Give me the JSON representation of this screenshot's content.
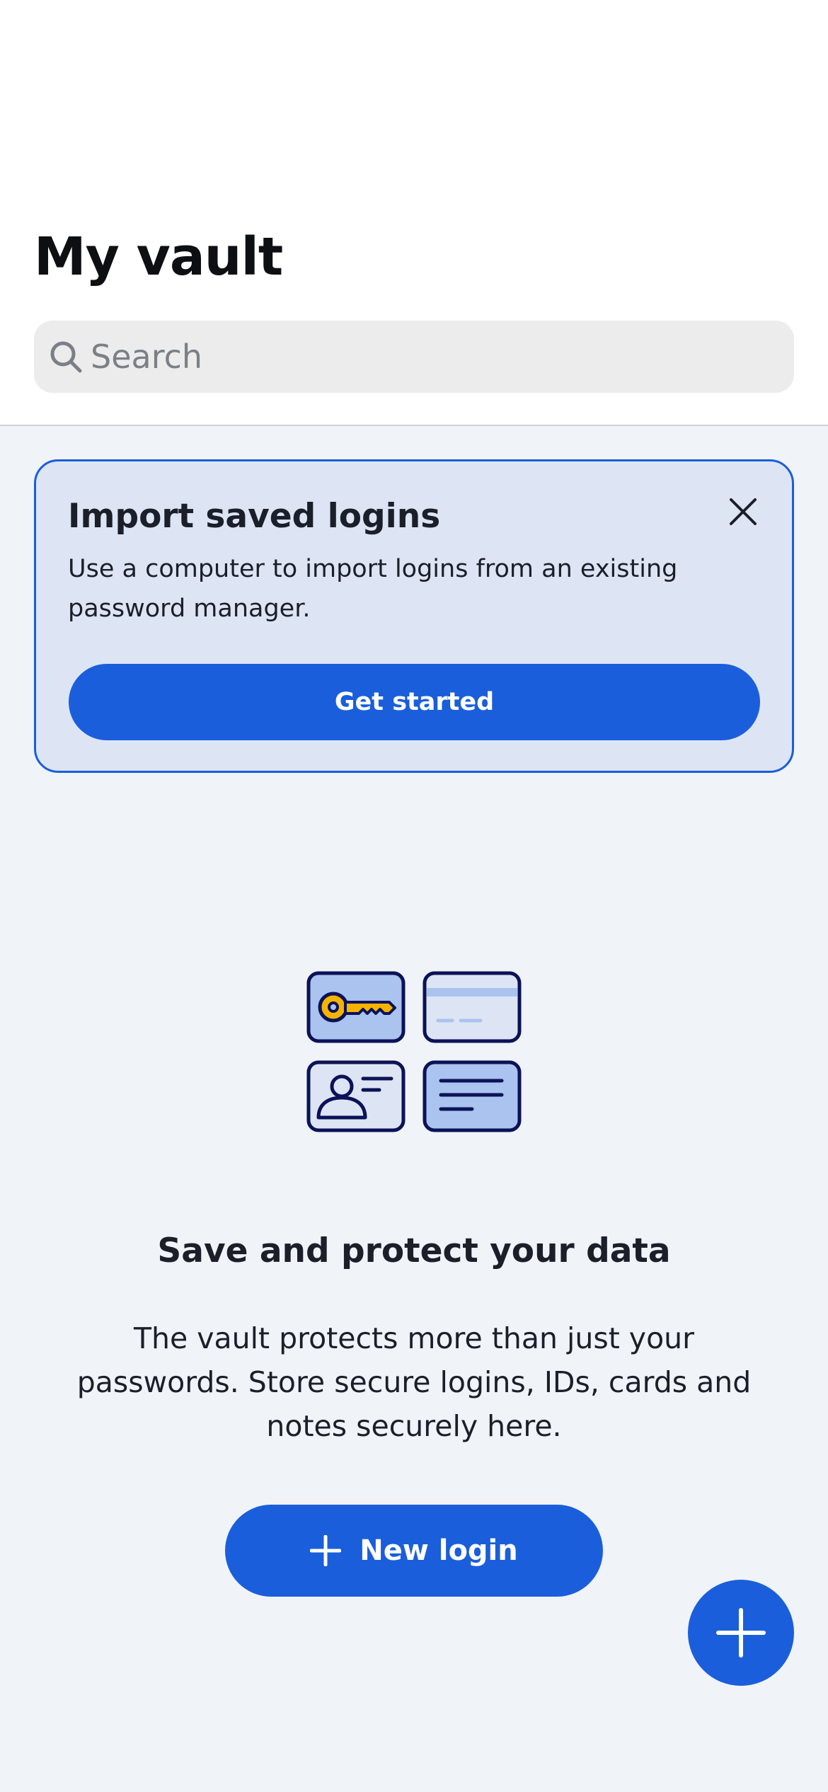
{
  "header": {
    "title": "My vault",
    "search_placeholder": "Search",
    "search_icon": "search-icon"
  },
  "import_card": {
    "title": "Import saved logins",
    "body": "Use a computer to import logins from an existing password manager.",
    "button_label": "Get started",
    "close_icon": "close-icon"
  },
  "empty_state": {
    "illustration_icons": [
      "key-card-icon",
      "credit-card-icon",
      "identity-card-icon",
      "secure-note-icon"
    ],
    "title": "Save and protect your data",
    "body": "The vault protects more than just your passwords. Store secure logins, IDs, cards and notes securely here.",
    "button_label": "New login",
    "button_icon": "plus-icon"
  },
  "fab": {
    "icon": "plus-icon"
  },
  "colors": {
    "accent": "#1a5edb",
    "card_background": "#dde5f4",
    "page_background": "#f0f3f7",
    "key_gold": "#f5b300",
    "illustration_outline": "#0b1257",
    "illustration_fill": "#aac3ef"
  }
}
